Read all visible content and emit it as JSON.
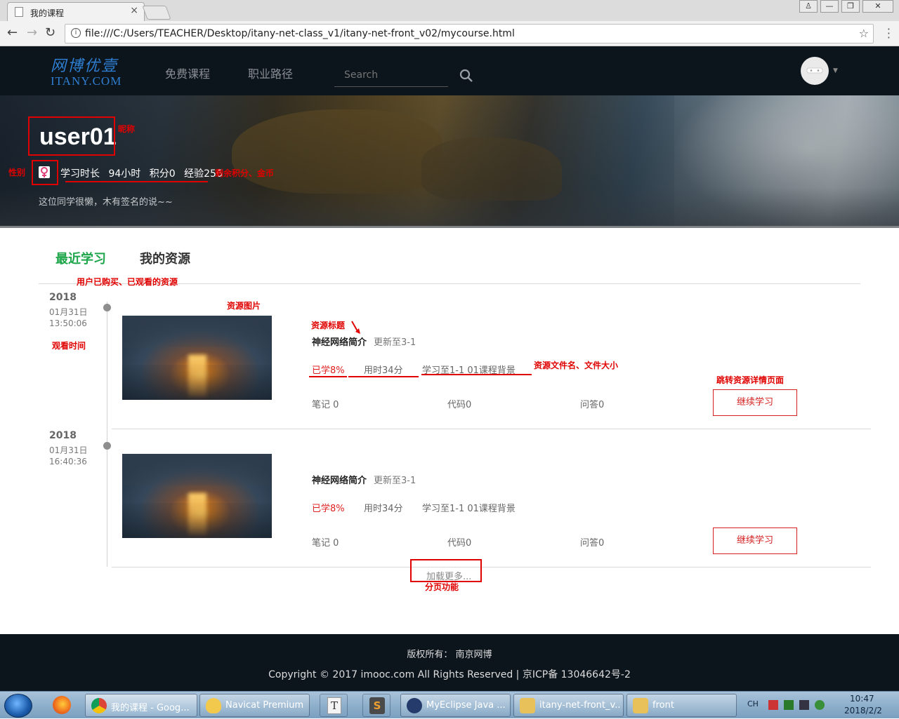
{
  "browser": {
    "tab_title": "我的课程",
    "tab_close": "×",
    "url": "file:///C:/Users/TEACHER/Desktop/itany-net-class_v1/itany-net-front_v02/mycourse.html",
    "back": "←",
    "forward": "→",
    "reload": "↻",
    "star": "☆",
    "info": "i",
    "window_controls": [
      "♙",
      "—",
      "❐",
      "✕"
    ]
  },
  "header": {
    "logo_cn": "网博优壹",
    "logo_en": "ITANY.COM",
    "nav": [
      "免费课程",
      "职业路径"
    ],
    "search_placeholder": "Search",
    "avatar_caret": "▼",
    "brand_color": "#2e7fd2"
  },
  "profile": {
    "username": "user01",
    "gender_icon": "♀",
    "study_time_label": "学习时长",
    "study_time": "94小时",
    "points": "积分0",
    "experience": "经验256",
    "signature": "这位同学很懒，木有签名的说~~"
  },
  "annotations": {
    "nickname": "昵称",
    "gender": "性别",
    "remaining": "剩余积分、金币",
    "purchased": "用户已购买、已观看的资源",
    "resource_image": "资源图片",
    "watch_time": "观看时间",
    "resource_title": "资源标题",
    "resource_file": "资源文件名、文件大小",
    "detail_page": "跳转资源详情页面",
    "paging": "分页功能",
    "color": "#e00000"
  },
  "tabs": {
    "recent": "最近学习",
    "resources": "我的资源",
    "active_color": "#1ea64a"
  },
  "courses": [
    {
      "year": "2018",
      "date": "01月31日",
      "time": "13:50:06",
      "title": "神经网络简介",
      "update": "更新至3-1",
      "learned": "已学8%",
      "duration": "用时34分",
      "progress": "学习至1-1 01课程背景",
      "notes": "笔记 0",
      "code": "代码0",
      "qa": "问答0",
      "button": "继续学习"
    },
    {
      "year": "2018",
      "date": "01月31日",
      "time": "16:40:36",
      "title": "神经网络简介",
      "update": "更新至3-1",
      "learned": "已学8%",
      "duration": "用时34分",
      "progress": "学习至1-1 01课程背景",
      "notes": "笔记 0",
      "code": "代码0",
      "qa": "问答0",
      "button": "继续学习"
    }
  ],
  "load_more": "加载更多...",
  "footer": {
    "owner": "版权所有： 南京网博",
    "copyright": "Copyright © 2017 imooc.com All Rights Reserved | 京ICP备 13046642号-2"
  },
  "taskbar": {
    "items": [
      "我的课程 - Goog...",
      "Navicat Premium",
      "MyEclipse Java ...",
      "itany-net-front_v...",
      "front"
    ],
    "lang": "CH",
    "clock_time": "10:47",
    "clock_date": "2018/2/2"
  }
}
